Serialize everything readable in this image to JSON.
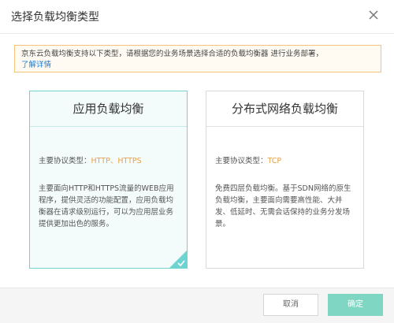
{
  "dialog": {
    "title": "选择负载均衡类型"
  },
  "notice": {
    "text": "京东云负载均衡支持以下类型，请根据您的业务场景选择合适的负载均衡器 进行业务部署，",
    "link": "了解详情"
  },
  "cards": [
    {
      "title": "应用负载均衡",
      "proto_label": "主要协议类型：",
      "proto_value": "HTTP、HTTPS",
      "description": "主要面向HTTP和HTTPS流量的WEB应用程序，提供灵活的功能配置，应用负载均衡器在请求级别运行，可以为应用层业务提供更加出色的服务。",
      "selected": true
    },
    {
      "title": "分布式网络负载均衡",
      "proto_label": "主要协议类型：",
      "proto_value": "TCP",
      "description": "免费四层负载均衡。基于SDN网络的原生负载均衡，主要面向需要高性能、大并发、低延时、无需会话保持的业务分发场景。",
      "selected": false
    }
  ],
  "footer": {
    "cancel_label": "取消",
    "ok_label": "确定"
  },
  "colors": {
    "accent": "#6fd3d1",
    "ok_button": "#7fd6c2",
    "protocol_value": "#e8a14a",
    "link": "#1a7bd6",
    "notice_border": "#f3c47a"
  }
}
